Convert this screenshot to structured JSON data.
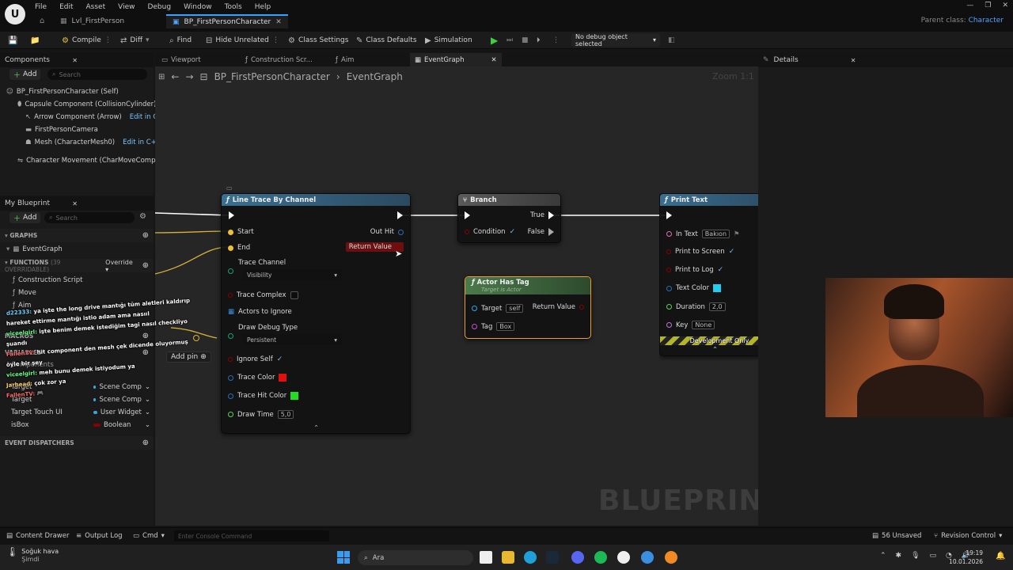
{
  "menu": [
    "File",
    "Edit",
    "Asset",
    "View",
    "Debug",
    "Window",
    "Tools",
    "Help"
  ],
  "doc_tabs": {
    "level": "Lvl_FirstPerson",
    "blueprint": "BP_FirstPersonCharacter"
  },
  "parent_class": {
    "label": "Parent class:",
    "value": "Character"
  },
  "toolbar": {
    "compile": "Compile",
    "diff": "Diff",
    "find": "Find",
    "hide_unrelated": "Hide Unrelated",
    "class_settings": "Class Settings",
    "class_defaults": "Class Defaults",
    "simulation": "Simulation",
    "debug_object": "No debug object selected"
  },
  "components": {
    "title": "Components",
    "add": "Add",
    "search_placeholder": "Search",
    "items": [
      {
        "label": "BP_FirstPersonCharacter (Self)",
        "edit": ""
      },
      {
        "label": "Capsule Component (CollisionCylinder)",
        "edit": ""
      },
      {
        "label": "Arrow Component (Arrow)",
        "edit": "Edit in C++"
      },
      {
        "label": "FirstPersonCamera",
        "edit": ""
      },
      {
        "label": "Mesh (CharacterMesh0)",
        "edit": "Edit in C++"
      },
      {
        "label": "Character Movement (CharMoveComp)",
        "edit": ""
      }
    ]
  },
  "my_blueprint": {
    "title": "My Blueprint",
    "add": "Add",
    "search_placeholder": "Search",
    "graphs_header": "GRAPHS",
    "graph_item": "EventGraph",
    "functions_header": "FUNCTIONS",
    "functions_count": "(39 OVERRIDABLE)",
    "override": "Override",
    "functions": [
      "Construction Script",
      "Move",
      "Aim"
    ],
    "macros_header": "MACROS",
    "variables_header": "VARIABLES",
    "components_header": "Components",
    "variables": [
      {
        "name": "Target",
        "type": "Scene Comp",
        "color": "#35a7e0"
      },
      {
        "name": "Target",
        "type": "Scene Comp",
        "color": "#35a7e0"
      },
      {
        "name": "Target Touch UI",
        "type": "User Widget",
        "color": "#35a7e0"
      },
      {
        "name": "isBox",
        "type": "Boolean",
        "color": "#8b0000"
      }
    ],
    "event_dispatchers": "EVENT DISPATCHERS",
    "add_pin": "Add pin"
  },
  "graph_tabs": [
    "Viewport",
    "Construction Scr...",
    "Aim",
    "EventGraph"
  ],
  "breadcrumb": {
    "root": "BP_FirstPersonCharacter",
    "child": "EventGraph"
  },
  "zoom": "Zoom 1:1",
  "watermark": "BLUEPRINT",
  "nodes": {
    "line_trace": {
      "title": "Line Trace By Channel",
      "start": "Start",
      "end": "End",
      "out_hit": "Out Hit",
      "return_value": "Return Value",
      "trace_channel": "Trace Channel",
      "trace_channel_value": "Visibility",
      "trace_complex": "Trace Complex",
      "actors_to_ignore": "Actors to Ignore",
      "draw_debug_type": "Draw Debug Type",
      "draw_debug_value": "Persistent",
      "ignore_self": "Ignore Self",
      "trace_color": "Trace Color",
      "trace_hit_color": "Trace Hit Color",
      "draw_time": "Draw Time",
      "draw_time_value": "5,0",
      "trace_color_hex": "#e01010",
      "trace_hit_color_hex": "#22dd22"
    },
    "branch": {
      "title": "Branch",
      "condition": "Condition",
      "true_label": "True",
      "false_label": "False"
    },
    "actor_has_tag": {
      "title": "Actor Has Tag",
      "subtitle": "Target is Actor",
      "target": "Target",
      "target_value": "self",
      "tag": "Tag",
      "tag_value": "Box",
      "return_value": "Return Value"
    },
    "print_text": {
      "title": "Print Text",
      "in_text": "In Text",
      "in_text_value": "Bakıon",
      "print_to_screen": "Print to Screen",
      "print_to_log": "Print to Log",
      "text_color": "Text Color",
      "duration": "Duration",
      "duration_value": "2,0",
      "key": "Key",
      "key_value": "None",
      "dev_only": "Development Only",
      "text_color_hex": "#22ccee"
    }
  },
  "details": {
    "title": "Details"
  },
  "chat": [
    {
      "user": "d22333:",
      "text": "ya işte the long drive mantığı tüm aletleri kaldırıp",
      "color": "#6ad0ff"
    },
    {
      "user": "",
      "text": "hareket ettirme mantığı istio adam ama nasııl",
      "color": "#ffffff"
    },
    {
      "user": "viceelgirl:",
      "text": "işte benim demek istediğim tagi nasıl checkliyo",
      "color": "#6aff8a"
    },
    {
      "user": "",
      "text": "şuandı",
      "color": "#ffffff"
    },
    {
      "user": "FallenTV:",
      "text": "hit component den mesh çek dicende oluyormuş",
      "color": "#ff6a6a"
    },
    {
      "user": "",
      "text": "öyle bir şey",
      "color": "#ffffff"
    },
    {
      "user": "viceelgirl:",
      "text": "meh bunu demek istiyodum ya",
      "color": "#6aff8a"
    },
    {
      "user": "Jarhead:",
      "text": "çok zor ya",
      "color": "#ffd36a"
    },
    {
      "user": "FallenTV:",
      "text": "🎮",
      "color": "#ff6a6a"
    }
  ],
  "status": {
    "content_drawer": "Content Drawer",
    "output_log": "Output Log",
    "cmd": "Cmd",
    "console_placeholder": "Enter Console Command",
    "unsaved": "56 Unsaved",
    "revision": "Revision Control"
  },
  "taskbar": {
    "weather_title": "Soğuk hava",
    "weather_sub": "Şimdi",
    "search": "Ara",
    "time": "19:19",
    "date": "10.01.2026"
  }
}
